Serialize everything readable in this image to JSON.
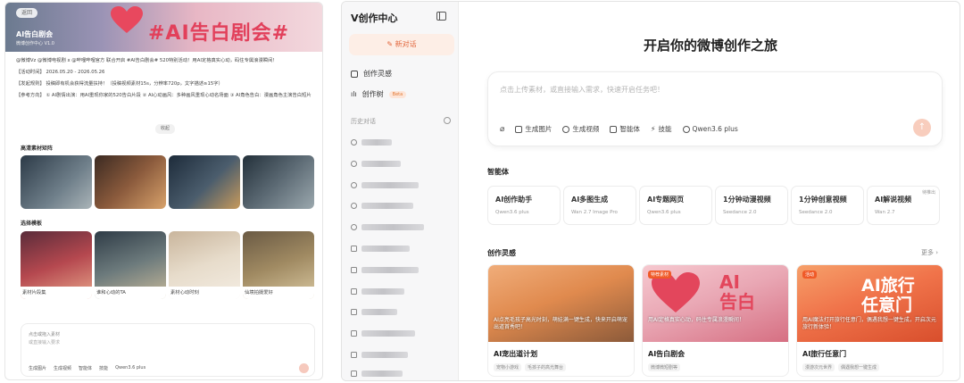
{
  "left_panel": {
    "back_label": "返回",
    "hero_title": "AI告白剧会",
    "hero_subtitle": "微博创作中心 V1.0",
    "hero_banner": "#AI告白剧会#",
    "paragraphs": [
      "@微博Vz @微博电视剧 x @哔哩哔哩官方 联合开启 #AI告白剧会# 520特别活动！用AI定格真实心动，码住专属浪漫瞬间！",
      "【活动时间】 2026.05.20 - 2026.05.26",
      "【发起规则】 投稿即有机会获得流量扶持！（投稿视频素材15s，分辨率720p，文字描述≥15字）",
      "【参考方向】 ① AI剧情出演：用AI重现你家的520告白片段 ② AI心动画风：多种画风重现心动名场面 ③ AI角色告白：漫画角色主演告白短片"
    ],
    "collapse_label": "收起",
    "section_materials": "高清素材矩阵",
    "section_templates": "选择模板",
    "templates": [
      {
        "label": "素材片段集"
      },
      {
        "label": "谁和心动的TA"
      },
      {
        "label": "素材心动时刻"
      },
      {
        "label": "仙境拍摄爱好"
      }
    ],
    "composer": {
      "placeholder_1": "点击或拖入素材",
      "placeholder_2": "或直接输入要求",
      "tools": [
        "生成图片",
        "生成视频",
        "智能体",
        "技能",
        "Qwen3.6 plus"
      ]
    }
  },
  "sidebar": {
    "brand": "V创作中心",
    "new_chat": "新对话",
    "nav": [
      {
        "label": "创作灵感"
      },
      {
        "label": "创作树",
        "badge": "Beta"
      }
    ],
    "history_title": "历史对话"
  },
  "main": {
    "title": "开启你的微博创作之旅",
    "composer_placeholder": "点击上传素材，或直接输入需求，快速开启任务吧！",
    "tools": [
      {
        "label": "",
        "icon": "paperclip-icon"
      },
      {
        "label": "生成图片",
        "icon": "image-icon"
      },
      {
        "label": "生成视频",
        "icon": "video-icon"
      },
      {
        "label": "智能体",
        "icon": "agent-icon"
      },
      {
        "label": "技能",
        "icon": "skill-icon"
      },
      {
        "label": "Qwen3.6 plus",
        "icon": "model-icon"
      }
    ],
    "agents_title": "智能体",
    "agents": [
      {
        "name": "AI创作助手",
        "model": "Qwen3.6 plus",
        "tag": ""
      },
      {
        "name": "AI多图生成",
        "model": "Wan 2.7 Image Pro",
        "tag": ""
      },
      {
        "name": "AI专题网页",
        "model": "Qwen3.6 plus",
        "tag": ""
      },
      {
        "name": "1分钟动漫视频",
        "model": "Seedance 2.0",
        "tag": ""
      },
      {
        "name": "1分钟创意视频",
        "model": "Seedance 2.0",
        "tag": ""
      },
      {
        "name": "AI解说视频",
        "model": "Wan 2.7",
        "tag": "待推出"
      }
    ],
    "inspiration_title": "创作灵感",
    "more": "更多 ›",
    "cards": [
      {
        "badge": "",
        "overlay": "AI点亮毛孩子高光时刻，萌娃满一键生成，快来开启萌宠出道首秀吧！",
        "title": "AI宠出道计划",
        "tags": [
          "宠物小游戏",
          "毛孩子的高光舞台"
        ]
      },
      {
        "badge": "特荐素材",
        "overlay": "用AI定格真实心动，码住专属浪漫瞬间！",
        "title": "AI告白剧会",
        "tags": [
          "微博微短剧等"
        ]
      },
      {
        "badge": "活动",
        "overlay": "用AI魔法打开旅行任意门，偶遇我想一键生成，开启次元旅行新体验！",
        "title": "AI旅行任意门",
        "tags": [
          "漫游次元世界",
          "偶遇我想一键生成"
        ]
      }
    ]
  }
}
